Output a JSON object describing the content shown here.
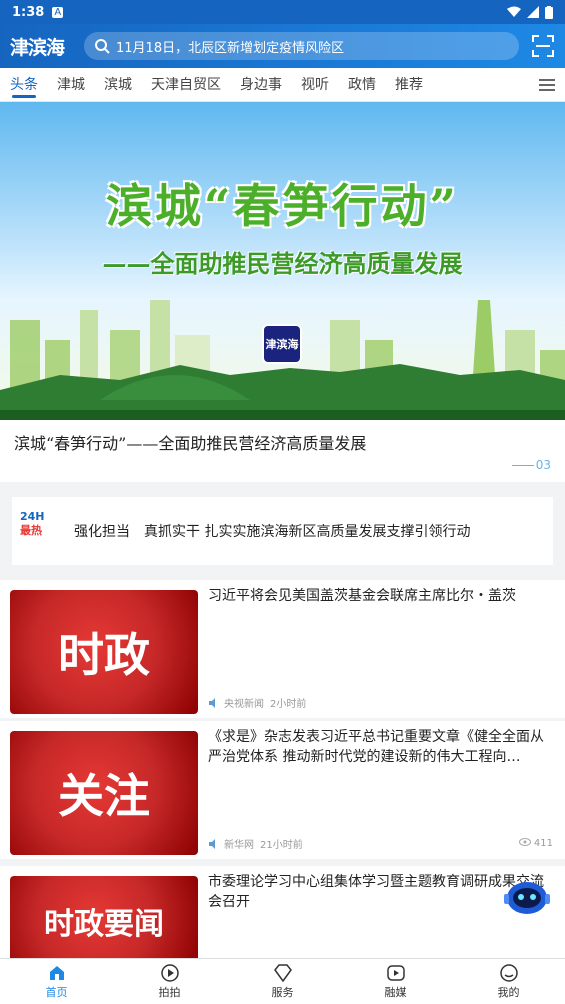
{
  "status": {
    "time": "1:38",
    "a_icon": "A"
  },
  "header": {
    "logo": "津滨海",
    "search_placeholder": "11月18日，北辰区新增划定疫情风险区"
  },
  "tabs": [
    "头条",
    "津城",
    "滨城",
    "天津自贸区",
    "身边事",
    "视听",
    "政情",
    "推荐"
  ],
  "banner": {
    "title": "滨城“春笋行动”",
    "subtitle": "——全面助推民营经济高质量发展",
    "logo": "津滨海",
    "caption": "滨城“春笋行动”——全面助推民营经济高质量发展",
    "index": "03"
  },
  "hot": {
    "badge_top": "24H",
    "badge_bottom": "最热",
    "text": "强化担当　真抓实干 扎实实施滨海新区高质量发展支撑引领行动"
  },
  "news": [
    {
      "thumb": "时政",
      "title": "习近平将会见美国盖茨基金会联席主席比尔・盖茨",
      "source": "央视新闻",
      "time": "2小时前",
      "views": ""
    },
    {
      "thumb": "关注",
      "title": "《求是》杂志发表习近平总书记重要文章《健全全面从严治党体系 推动新时代党的建设新的伟大工程向…",
      "source": "新华网",
      "time": "21小时前",
      "views": "411"
    },
    {
      "thumb": "时政要闻",
      "title": "市委理论学习中心组集体学习暨主题教育调研成果交流会召开",
      "source": "",
      "time": "",
      "views": ""
    }
  ],
  "bottom_nav": [
    "首页",
    "拍拍",
    "服务",
    "融媒",
    "我的"
  ],
  "colors": {
    "primary": "#1565c0",
    "accent_red": "#c62828",
    "green": "#4caf2a"
  }
}
